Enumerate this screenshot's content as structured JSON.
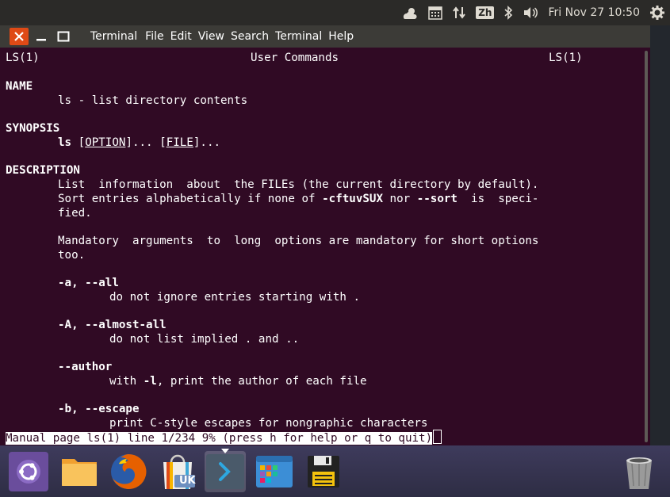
{
  "panel": {
    "ime_label": "Zh",
    "clock": "Fri Nov 27 10:50"
  },
  "window": {
    "menu": [
      "Terminal",
      "File",
      "Edit",
      "View",
      "Search",
      "Terminal",
      "Help"
    ]
  },
  "manpage": {
    "header_left": "LS(1)",
    "header_center": "User Commands",
    "header_right": "LS(1)",
    "name_heading": "NAME",
    "name_text": "ls - list directory contents",
    "synopsis_heading": "SYNOPSIS",
    "synopsis_cmd": "ls",
    "synopsis_option": "OPTION",
    "synopsis_file": "FILE",
    "description_heading": "DESCRIPTION",
    "desc_1": "List  information  about  the FILEs (the current directory by default).",
    "desc_2a": "Sort entries alphabetically if none of ",
    "desc_2b": "-cftuvSUX",
    "desc_2c": " nor ",
    "desc_2d": "--sort",
    "desc_2e": "  is  speci‐",
    "desc_3": "fied.",
    "desc_4": "Mandatory  arguments  to  long  options are mandatory for short options",
    "desc_5": "too.",
    "opt_a": "-a, --all",
    "opt_a_desc": "do not ignore entries starting with .",
    "opt_A": "-A, --almost-all",
    "opt_A_desc": "do not list implied . and ..",
    "opt_author": "--author",
    "opt_author_desc_a": "with ",
    "opt_author_desc_b": "-l",
    "opt_author_desc_c": ", print the author of each file",
    "opt_b": "-b, --escape",
    "opt_b_desc": "print C-style escapes for nongraphic characters",
    "status_line": "Manual page ls(1) line 1/234 9% (press h for help or q to quit)"
  },
  "dock": {
    "items": [
      "ubuntu-dash",
      "files",
      "firefox",
      "ubuntu-software",
      "terminal",
      "app-grid",
      "save",
      "trash"
    ],
    "software_badge": "UK"
  }
}
